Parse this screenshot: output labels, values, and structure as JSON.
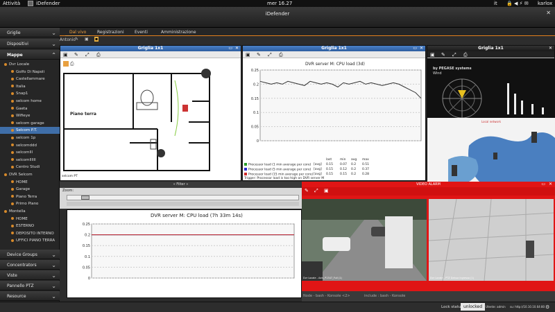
{
  "os_bar": {
    "activities": "Attività",
    "app_name": "iDefender",
    "clock": "mer 16.27",
    "lang": "it",
    "user": "karlox"
  },
  "window": {
    "title": "iDefender"
  },
  "sidebar": {
    "sections": [
      {
        "label": "Griglie"
      },
      {
        "label": "Dispositivi"
      },
      {
        "label": "Mappe"
      }
    ],
    "tree": [
      {
        "label": "Dvr Locale",
        "level": 0
      },
      {
        "label": "Golfo Di Napoli",
        "level": 1
      },
      {
        "label": "Castellammare",
        "level": 1
      },
      {
        "label": "Italia",
        "level": 1
      },
      {
        "label": "Snap1",
        "level": 1
      },
      {
        "label": "selcom home",
        "level": 1
      },
      {
        "label": "Gaeta",
        "level": 1
      },
      {
        "label": "Wifieye",
        "level": 1
      },
      {
        "label": "selcom garage",
        "level": 1
      },
      {
        "label": "Selcom P.T.",
        "level": 1,
        "selected": true
      },
      {
        "label": "selcom 1p",
        "level": 1
      },
      {
        "label": "selcomddd",
        "level": 1
      },
      {
        "label": "selcomlll",
        "level": 1
      },
      {
        "label": "selcomllllll",
        "level": 1
      },
      {
        "label": "Centro Studi",
        "level": 1
      },
      {
        "label": "DVR Selcom",
        "level": 0
      },
      {
        "label": "HOME",
        "level": 1
      },
      {
        "label": "Garage",
        "level": 1
      },
      {
        "label": "Piano Terra",
        "level": 1
      },
      {
        "label": "Primo Piano",
        "level": 1
      },
      {
        "label": "Montella",
        "level": 0
      },
      {
        "label": "HOME",
        "level": 1
      },
      {
        "label": "ESTERNO",
        "level": 1
      },
      {
        "label": "DEPOSITO INTERNO",
        "level": 1
      },
      {
        "label": "UFFICI PIANO TERRA",
        "level": 1
      }
    ],
    "bottom_sections": [
      {
        "label": "Device Groups"
      },
      {
        "label": "Concentrators"
      },
      {
        "label": "Viste"
      },
      {
        "label": "Pannello PTZ"
      },
      {
        "label": "Resource"
      }
    ]
  },
  "tabs": [
    {
      "label": "Dal vivo",
      "active": true
    },
    {
      "label": "Registrazioni"
    },
    {
      "label": "Eventi"
    },
    {
      "label": "Amministrazione"
    }
  ],
  "toolbar2": {
    "label": "Antonio"
  },
  "panel_map": {
    "title": "Griglia 1x1",
    "room_label": "Piano terra",
    "footer": "selcom PT"
  },
  "panel_chart": {
    "title": "Griglia 1x1",
    "chart_title": "DVR server M: CPU load (3d)",
    "legend_header": [
      "last",
      "min",
      "avg",
      "max"
    ],
    "legend": [
      {
        "color": "#2a9d2a",
        "label": "Processor load (1 min average per core)",
        "kind": "[avg]",
        "vals": [
          "0.15",
          "0.07",
          "0.2",
          "0.51"
        ]
      },
      {
        "color": "#2a2acf",
        "label": "Processor load (5 min average per core)",
        "kind": "[avg]",
        "vals": [
          "0.15",
          "0.12",
          "0.2",
          "0.37"
        ]
      },
      {
        "color": "#cf2a2a",
        "label": "Processor load (15 min average per core)",
        "kind": "[avg]",
        "vals": [
          "0.15",
          "0.15",
          "0.2",
          "0.28"
        ]
      }
    ],
    "trigger": "Trigger: Processor load is too high on DVR server M"
  },
  "panel_wind": {
    "title": "Griglia 1x1",
    "brand": "by PEGASE systems",
    "sub": "Wind",
    "map_label": "Local network"
  },
  "filter_bar": {
    "label": "« Filter »"
  },
  "zoom_bar": {
    "label": "Zoom:"
  },
  "chart_data": [
    {
      "type": "line",
      "title": "DVR server M: CPU load (3d)",
      "ylim": [
        0,
        0.25
      ],
      "yticks": [
        "0.25",
        "0.2",
        "0.15",
        "0.1",
        "0.05",
        "0"
      ],
      "series": [
        {
          "name": "Processor load (1 min average per core)",
          "color": "#333333",
          "values": [
            0.21,
            0.205,
            0.2,
            0.205,
            0.2,
            0.21,
            0.205,
            0.2,
            0.195,
            0.21,
            0.205,
            0.2,
            0.205,
            0.2,
            0.19,
            0.205,
            0.2,
            0.205,
            0.21,
            0.2,
            0.205,
            0.2,
            0.195,
            0.2,
            0.205,
            0.2,
            0.19,
            0.18,
            0.17,
            0.15
          ]
        }
      ]
    },
    {
      "type": "line",
      "title": "DVR server M: CPU load (7h 33m 14s)",
      "ylim": [
        0,
        0.25
      ],
      "yticks": [
        "0.25",
        "0.2",
        "0.15",
        "0.1",
        "0.05",
        "0"
      ],
      "series": [
        {
          "name": "Processor load (1 min average per core)",
          "color": "#2a9d2a",
          "values": [
            0.2,
            0.2,
            0.2,
            0.2,
            0.2,
            0.2,
            0.2,
            0.2,
            0.2,
            0.2,
            0.2,
            0.2,
            0.2,
            0.2,
            0.2,
            0.2,
            0.2,
            0.2,
            0.2,
            0.2
          ]
        },
        {
          "name": "Processor load (5 min average per core)",
          "color": "#2a2acf",
          "values": [
            0.2,
            0.2,
            0.2,
            0.2,
            0.2,
            0.2,
            0.2,
            0.2,
            0.2,
            0.2,
            0.2,
            0.2,
            0.2,
            0.2,
            0.2,
            0.2,
            0.2,
            0.2,
            0.2,
            0.2
          ]
        },
        {
          "name": "Processor load (15 min average per core)",
          "color": "#cf2a2a",
          "values": [
            0.2,
            0.2,
            0.2,
            0.2,
            0.2,
            0.2,
            0.2,
            0.2,
            0.2,
            0.2,
            0.2,
            0.2,
            0.2,
            0.2,
            0.2,
            0.2,
            0.2,
            0.2,
            0.2,
            0.2
          ]
        }
      ]
    }
  ],
  "video_alarm": {
    "title": "VIDEO ALARM",
    "cam1_label": "Dvr Locale - Axis_P1347_Full (1)",
    "cam2_label": "Dvr Locale - PTZ Dahua ingresso (1)"
  },
  "bottom_taskbar": [
    {
      "label": "Node - bash - Konsole <2>"
    },
    {
      "label": "include : bash - Konsole"
    }
  ],
  "status": {
    "lock_label": "Lock status",
    "lock_value": "unlocked",
    "user": "Utente: admin",
    "server": "su: http://10.10.10.64:80"
  },
  "colors": {
    "accent": "#e5801c",
    "panel_title": "#3a6fb8",
    "alarm_red": "#e01515",
    "selected": "#3f6ea8"
  }
}
